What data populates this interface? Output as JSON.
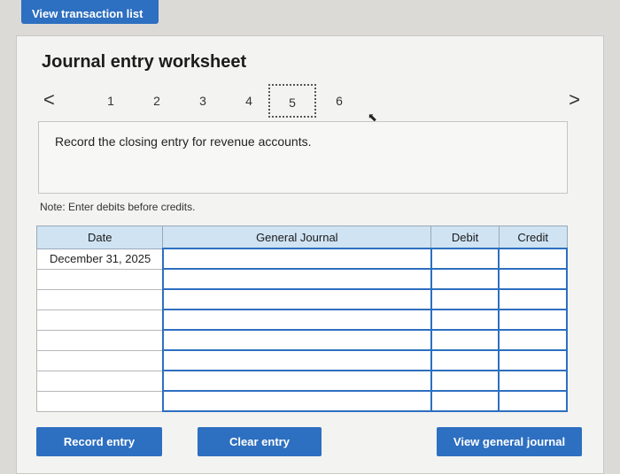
{
  "header": {
    "view_transactions_label": "View transaction list"
  },
  "worksheet": {
    "title": "Journal entry worksheet",
    "steps": [
      "1",
      "2",
      "3",
      "4",
      "5",
      "6"
    ],
    "active_step": "5",
    "prev_arrow": "<",
    "next_arrow": ">",
    "instruction": "Record the closing entry for revenue accounts.",
    "note": "Note: Enter debits before credits."
  },
  "table": {
    "headers": {
      "date": "Date",
      "general_journal": "General Journal",
      "debit": "Debit",
      "credit": "Credit"
    },
    "rows": [
      {
        "date": "December 31, 2025"
      },
      {
        "date": ""
      },
      {
        "date": ""
      },
      {
        "date": ""
      },
      {
        "date": ""
      },
      {
        "date": ""
      },
      {
        "date": ""
      },
      {
        "date": ""
      }
    ]
  },
  "buttons": {
    "record": "Record entry",
    "clear": "Clear entry",
    "view_journal": "View general journal"
  }
}
